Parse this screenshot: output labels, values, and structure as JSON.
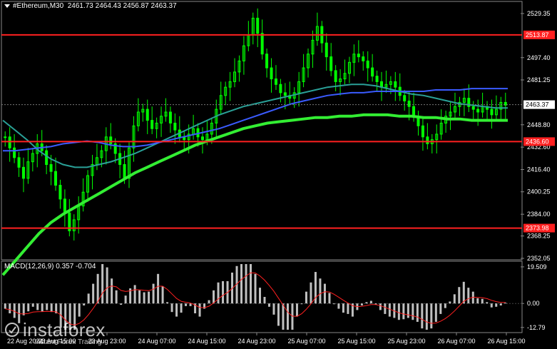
{
  "header": {
    "symbol": "#Ethereum,M30",
    "ohlc": "2461.73 2464.43 2456.87 2463.37"
  },
  "macd_header": "MACD(12,26,9) 0.357 -0.704",
  "brand": {
    "name": "instaforex",
    "tagline": "Instant Forex Trading"
  },
  "colors": {
    "background": "#000000",
    "candle": "#00ff00",
    "ma_fast": "#2aa198",
    "ma_mid": "#3a5bff",
    "ma_slow": "#33ee33",
    "level": "#ff2020",
    "macd_hist": "#c0c0c0",
    "macd_signal": "#ff2020",
    "axis_text": "#ffffff"
  },
  "chart_data": {
    "type": "candlestick",
    "timeframe": "M30",
    "price_axis": {
      "ticks": [
        "2529.35",
        "2497.40",
        "2481.25",
        "2448.80",
        "2432.60",
        "2416.40",
        "2400.25",
        "2384.00",
        "2368.25",
        "2352.05"
      ],
      "ylim": [
        2352.05,
        2535
      ]
    },
    "time_axis": {
      "ticks": [
        "22 Aug 2024",
        "23 Aug 15:00",
        "23 Aug 23:00",
        "24 Aug 07:00",
        "24 Aug 15:00",
        "24 Aug 23:00",
        "25 Aug 07:00",
        "25 Aug 15:00",
        "25 Aug 23:00",
        "26 Aug 07:00",
        "26 Aug 15:00"
      ]
    },
    "current_price": "2463.37",
    "levels": [
      {
        "label": "2513.87",
        "value": 2513.87
      },
      {
        "label": "2436.60",
        "value": 2436.6
      },
      {
        "label": "2373.98",
        "value": 2373.98
      }
    ],
    "close_series": [
      2440,
      2432,
      2425,
      2418,
      2410,
      2422,
      2428,
      2435,
      2430,
      2420,
      2415,
      2405,
      2395,
      2385,
      2372,
      2380,
      2390,
      2400,
      2412,
      2420,
      2425,
      2430,
      2440,
      2435,
      2428,
      2420,
      2410,
      2432,
      2448,
      2458,
      2460,
      2452,
      2446,
      2450,
      2455,
      2458,
      2450,
      2445,
      2440,
      2438,
      2442,
      2446,
      2440,
      2438,
      2442,
      2450,
      2460,
      2470,
      2476,
      2480,
      2487,
      2495,
      2506,
      2514,
      2526,
      2515,
      2500,
      2490,
      2482,
      2478,
      2472,
      2470,
      2468,
      2472,
      2480,
      2490,
      2500,
      2510,
      2520,
      2508,
      2498,
      2488,
      2480,
      2482,
      2486,
      2494,
      2500,
      2498,
      2495,
      2490,
      2484,
      2480,
      2476,
      2478,
      2480,
      2476,
      2470,
      2466,
      2462,
      2455,
      2448,
      2440,
      2435,
      2438,
      2442,
      2450,
      2455,
      2458,
      2462,
      2465,
      2468,
      2462,
      2460,
      2458,
      2462,
      2460,
      2456,
      2460,
      2465,
      2463
    ],
    "moving_averages": [
      {
        "color": "#2aa198",
        "values": [
          2452,
          2445,
          2438,
          2430,
          2424,
          2420,
          2418,
          2418,
          2420,
          2422,
          2425,
          2428,
          2432,
          2436,
          2440,
          2444,
          2448,
          2452,
          2456,
          2459,
          2462,
          2464,
          2466,
          2468,
          2470,
          2472,
          2474,
          2476,
          2477,
          2478,
          2478,
          2477,
          2475,
          2473,
          2471,
          2470,
          2468,
          2466,
          2464,
          2463,
          2462,
          2461,
          2461
        ]
      },
      {
        "color": "#3a5bff",
        "values": [
          2430,
          2430,
          2431,
          2432,
          2433,
          2435,
          2436,
          2437,
          2436,
          2434,
          2433,
          2433,
          2434,
          2436,
          2438,
          2440,
          2442,
          2444,
          2446,
          2449,
          2452,
          2455,
          2458,
          2461,
          2464,
          2466,
          2468,
          2470,
          2471,
          2472,
          2472,
          2473,
          2473,
          2473,
          2473,
          2473,
          2474,
          2474,
          2474,
          2475,
          2475,
          2475,
          2475
        ]
      },
      {
        "color": "#33ee33",
        "values": [
          2340,
          2350,
          2360,
          2370,
          2378,
          2384,
          2389,
          2394,
          2399,
          2404,
          2409,
          2414,
          2418,
          2422,
          2426,
          2430,
          2434,
          2437,
          2440,
          2443,
          2446,
          2448,
          2450,
          2451,
          2452,
          2453,
          2454,
          2454,
          2455,
          2455,
          2456,
          2456,
          2456,
          2455,
          2455,
          2454,
          2454,
          2453,
          2453,
          2452,
          2452,
          2452,
          2452
        ]
      }
    ],
    "macd": {
      "title": "MACD(12,26,9)",
      "main": "0.357",
      "signal": "-0.704",
      "ticks": [
        "19.509",
        "0.00",
        "-12.79"
      ],
      "ylim": [
        -14,
        21
      ]
    }
  }
}
